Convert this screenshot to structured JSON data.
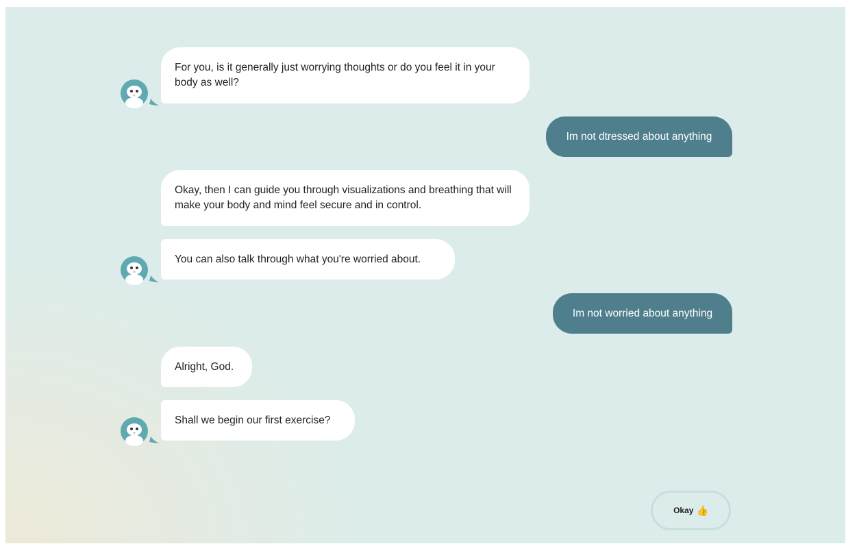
{
  "conversation": {
    "messages": [
      {
        "sender": "bot",
        "text": "For you, is it generally just worrying thoughts or do you feel it in your body as well?"
      },
      {
        "sender": "user",
        "text": "Im not dtressed about anything"
      },
      {
        "sender": "bot",
        "text": "Okay, then I can guide you through visualizations and breathing that will make your body and mind feel secure and in control."
      },
      {
        "sender": "bot",
        "text": "You can also talk through what you're worried about."
      },
      {
        "sender": "user",
        "text": "Im not worried about anything"
      },
      {
        "sender": "bot",
        "text": "Alright, God."
      },
      {
        "sender": "bot",
        "text": "Shall we begin our first exercise?"
      }
    ]
  },
  "reply": {
    "label": "Okay",
    "icon": "thumbs-up-icon"
  },
  "colors": {
    "background": "#dcecea",
    "bot_bubble": "#ffffff",
    "user_bubble": "#4f7f8d",
    "avatar": "#5fa9b0"
  }
}
